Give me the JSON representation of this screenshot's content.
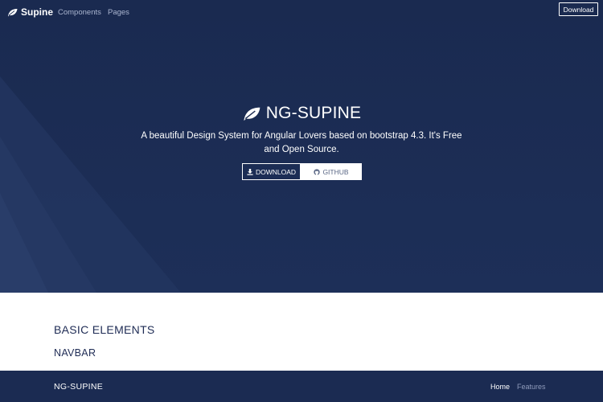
{
  "topnav": {
    "brand": "Supine",
    "links": [
      "Components",
      "Pages"
    ],
    "download_label": "Download"
  },
  "hero": {
    "title": "NG-SUPINE",
    "subtitle": "A beautiful Design System for Angular Lovers based on bootstrap 4.3. It's Free and Open Source.",
    "buttons": [
      {
        "label": "DOWNLOAD",
        "icon": "download-icon"
      },
      {
        "label": "GITHUB",
        "icon": "github-icon"
      }
    ]
  },
  "section": {
    "title": "BASIC ELEMENTS",
    "subtitle": "NAVBAR"
  },
  "demo_navbar": {
    "brand": "NG-SUPINE",
    "links": [
      "Home",
      "Features"
    ]
  },
  "colors": {
    "hero_bg": "#1b2b52",
    "text_heading": "#1f2c55",
    "muted_link": "#8f9bbb"
  }
}
